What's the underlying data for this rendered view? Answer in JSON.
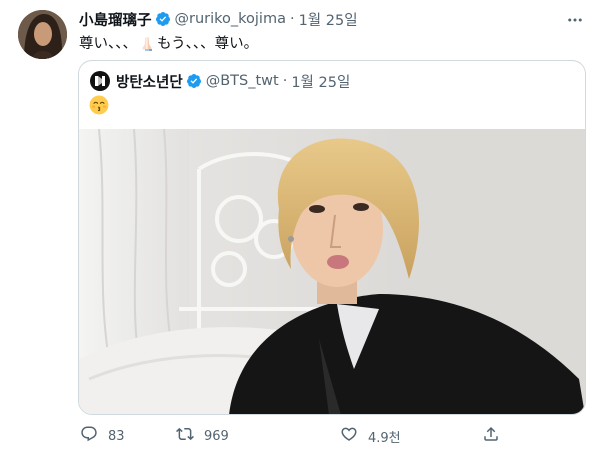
{
  "tweet": {
    "author_name": "小島瑠璃子",
    "handle": "@ruriko_kojima",
    "separator": "·",
    "date": "1월 25일",
    "text_part1": "尊い、、、",
    "text_emoji": "folded-hands-emoji",
    "text_part2": "もう、、、尊い。"
  },
  "quote": {
    "author_name": "방탄소년단",
    "handle": "@BTS_twt",
    "separator": "·",
    "date": "1월 25일",
    "emoji": "kissing-smiling-eyes-emoji"
  },
  "actions": {
    "reply_count": "83",
    "retweet_count": "969",
    "like_count": "4.9천",
    "share_icon": "share-icon"
  },
  "colors": {
    "verified": "#1d9bf0",
    "secondary_text": "#536471",
    "border": "#cfd9de"
  }
}
